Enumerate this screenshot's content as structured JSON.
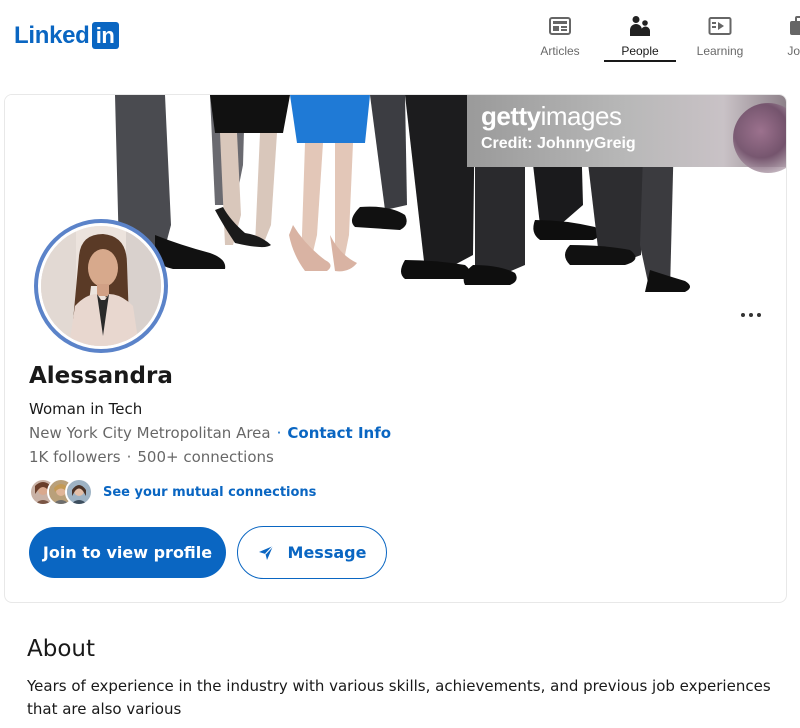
{
  "brand": {
    "logo_text": "Linked",
    "logo_box": "in",
    "color": "#0a66c2"
  },
  "nav": {
    "items": [
      {
        "label": "Articles",
        "icon": "articles-icon"
      },
      {
        "label": "People",
        "icon": "people-icon",
        "active": true
      },
      {
        "label": "Learning",
        "icon": "learning-icon"
      },
      {
        "label": "Jobs",
        "icon": "jobs-icon"
      }
    ]
  },
  "cover": {
    "watermark_brand": "getty",
    "watermark_brand_rest": "images",
    "watermark_credit": "Credit: JohnnyGreig"
  },
  "profile": {
    "name": "Alessandra",
    "headline": "Woman in Tech",
    "location": "New York City Metropolitan Area",
    "contact_info_label": "Contact Info",
    "followers": "1K followers",
    "connections": "500+ connections",
    "mutual_label": "See your mutual connections",
    "join_button": "Join to view profile",
    "message_button": "Message"
  },
  "about": {
    "title": "About",
    "text": "Years of experience in the industry with various skills, achievements, and previous job experiences that are also various"
  },
  "colors": {
    "accent": "#0a66c2",
    "avatar_ring": "#5b83c9"
  }
}
